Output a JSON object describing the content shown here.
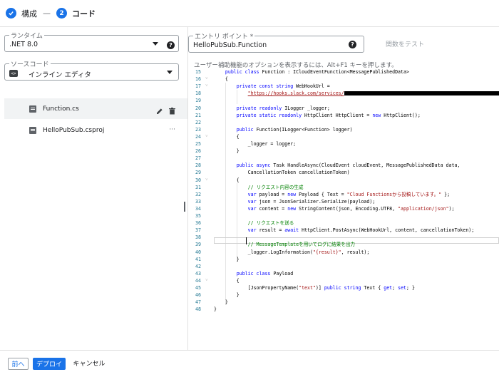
{
  "stepper": {
    "step1_label": "構成",
    "separator": "—",
    "step2_number": "2",
    "step2_label": "コード"
  },
  "left": {
    "runtime": {
      "label": "ランタイム",
      "value": ".NET 8.0"
    },
    "source": {
      "label": "ソースコード",
      "value": "インライン エディタ",
      "icon_text": "<>"
    },
    "files": [
      {
        "name": "Function.cs",
        "selected": true
      },
      {
        "name": "HelloPubSub.csproj",
        "selected": false
      }
    ],
    "more_menu": "···"
  },
  "entry_point": {
    "label": "エントリ ポイント *",
    "value": "HelloPubSub.Function"
  },
  "test_function_label": "関数をテスト",
  "hint": "ユーザー補助機能のオプションを表示するには、Alt+F1 キーを押します。",
  "help_glyph": "?",
  "icons": {
    "check": "check-icon",
    "help": "help-icon",
    "add": "add-icon",
    "edit": "edit-icon",
    "delete": "delete-icon",
    "file": "file-icon",
    "chevron": "chevron-down-icon"
  },
  "colors": {
    "accent": "#1a73e8",
    "keyword": "#0000ff",
    "string": "#a31515",
    "comment": "#008000",
    "line_number": "#237893"
  },
  "code": {
    "lines": [
      {
        "n": "15",
        "f": "",
        "html": "    <span class=\"kw\">public class</span> Function : ICloudEventFunction&lt;MessagePublishedData&gt;"
      },
      {
        "n": "16",
        "f": "v",
        "html": "    {"
      },
      {
        "n": "17",
        "f": "v",
        "html": "        <span class=\"kw\">private const string</span> WebHookUrl ="
      },
      {
        "n": "18",
        "f": "",
        "html": "            <span class=\"strlink\">\"https://hooks.slack.com/services/</span><span class=\"redact\"></span><span class=\"str\">\"</span>;"
      },
      {
        "n": "19",
        "f": "",
        "html": ""
      },
      {
        "n": "20",
        "f": "",
        "html": "        <span class=\"kw\">private readonly</span> ILogger _logger;"
      },
      {
        "n": "21",
        "f": "",
        "html": "        <span class=\"kw\">private static readonly</span> HttpClient HttpClient = <span class=\"kw\">new</span> HttpClient();"
      },
      {
        "n": "22",
        "f": "",
        "html": ""
      },
      {
        "n": "23",
        "f": "",
        "html": "        <span class=\"kw\">public</span> Function(ILogger&lt;Function&gt; logger)"
      },
      {
        "n": "24",
        "f": "v",
        "html": "        {"
      },
      {
        "n": "25",
        "f": "",
        "html": "            _logger = logger;"
      },
      {
        "n": "26",
        "f": "",
        "html": "        }"
      },
      {
        "n": "27",
        "f": "",
        "html": ""
      },
      {
        "n": "28",
        "f": "",
        "html": "        <span class=\"kw\">public async</span> Task HandleAsync(CloudEvent cloudEvent, MessagePublishedData data,"
      },
      {
        "n": "29",
        "f": "",
        "html": "            CancellationToken cancellationToken)"
      },
      {
        "n": "30",
        "f": "v",
        "html": "        {"
      },
      {
        "n": "31",
        "f": "",
        "html": "            <span class=\"cmt\">// リクエスト内容の生成</span>"
      },
      {
        "n": "32",
        "f": "",
        "html": "            <span class=\"kw\">var</span> payload = <span class=\"kw\">new</span> Payload { Text = <span class=\"str\">\"Cloud Functionsから投稿しています。\"</span> };"
      },
      {
        "n": "33",
        "f": "",
        "html": "            <span class=\"kw\">var</span> json = JsonSerializer.Serialize(payload);"
      },
      {
        "n": "34",
        "f": "",
        "html": "            <span class=\"kw\">var</span> content = <span class=\"kw\">new</span> StringContent(json, Encoding.UTF8, <span class=\"str\">\"application/json\"</span>);"
      },
      {
        "n": "35",
        "f": "",
        "html": ""
      },
      {
        "n": "36",
        "f": "",
        "html": "            <span class=\"cmt\">// リクエストを送る</span>"
      },
      {
        "n": "37",
        "f": "",
        "html": "            <span class=\"kw\">var</span> result = <span class=\"kw\">await</span> HttpClient.PostAsync(WebHookUrl, content, cancellationToken);"
      },
      {
        "n": "38",
        "f": "",
        "html": ""
      },
      {
        "n": "39",
        "f": "",
        "html": "            <span class=\"cmt\">// MessageTemplateを用いてログに結果を出力</span>"
      },
      {
        "n": "40",
        "f": "",
        "html": "            _logger.LogInformation(<span class=\"str\">\"{result}\"</span>, result);"
      },
      {
        "n": "41",
        "f": "",
        "html": "        }"
      },
      {
        "n": "42",
        "f": "",
        "html": ""
      },
      {
        "n": "43",
        "f": "",
        "html": "        <span class=\"kw\">public class</span> Payload"
      },
      {
        "n": "44",
        "f": "v",
        "html": "        {"
      },
      {
        "n": "45",
        "f": "",
        "html": "            [JsonPropertyName(<span class=\"str\">\"text\"</span>)] <span class=\"kw\">public string</span> Text { <span class=\"kw\">get</span>; <span class=\"kw\">set</span>; }"
      },
      {
        "n": "46",
        "f": "",
        "html": "        }"
      },
      {
        "n": "47",
        "f": "",
        "html": "    }"
      },
      {
        "n": "48",
        "f": "",
        "html": "}"
      }
    ]
  },
  "bottom": {
    "prev": "前へ",
    "deploy": "デプロイ",
    "cancel": "キャンセル"
  }
}
